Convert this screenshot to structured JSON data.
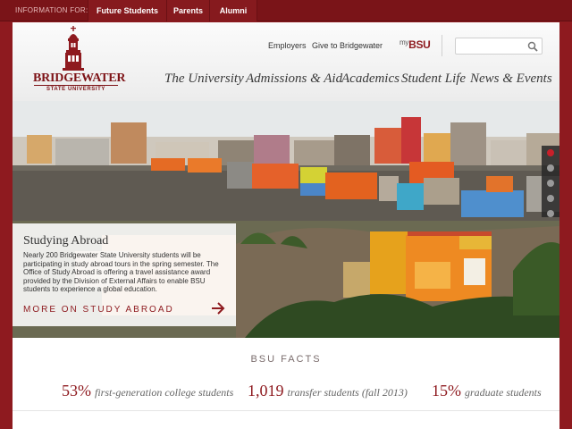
{
  "topbar": {
    "info_label": "INFORMATION FOR:",
    "links": [
      "Future Students",
      "Parents",
      "Alumni"
    ]
  },
  "logo": {
    "name": "BRIDGEWATER",
    "subtitle": "STATE UNIVERSITY"
  },
  "utility": {
    "links": [
      "Employers",
      "Give to Bridgewater"
    ],
    "mybsu_prefix": "my",
    "mybsu_brand": "BSU"
  },
  "search": {
    "placeholder": "",
    "value": ""
  },
  "nav": [
    "The University",
    "Admissions & Aid",
    "Academics",
    "Student Life",
    "News & Events"
  ],
  "hero": {
    "title": "Studying Abroad",
    "text": "Nearly 200 Bridgewater State University students will be participating in study abroad tours in the spring semester. The Office of Study Abroad is offering a travel assistance award provided by the Division of External Affairs to enable BSU students to experience a global education.",
    "more": "MORE ON STUDY ABROAD",
    "slides": 5,
    "active_slide": 1
  },
  "facts": {
    "title": "BSU FACTS",
    "items": [
      {
        "num": "53%",
        "label": "first-generation college students"
      },
      {
        "num": "1,019",
        "label": "transfer students (fall 2013)"
      },
      {
        "num": "15%",
        "label": "graduate students"
      }
    ]
  },
  "colors": {
    "brand": "#8e1a1f",
    "topbar": "#7a1418",
    "active_dot": "#c8202a"
  },
  "icons": [
    "search-icon",
    "arrow-right-icon",
    "tower-logo-icon"
  ]
}
